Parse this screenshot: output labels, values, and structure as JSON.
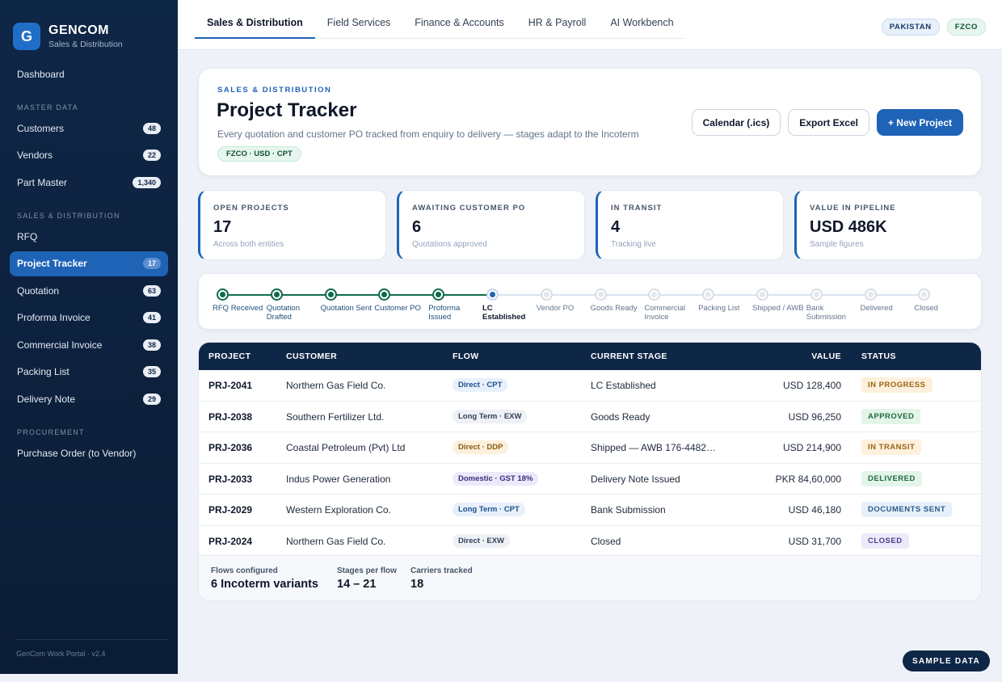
{
  "brand": {
    "logo_letter": "G",
    "title": "GENCOM",
    "subtitle": "Sales & Distribution"
  },
  "sidebar": {
    "dashboard": "Dashboard",
    "sections": [
      {
        "title": "MASTER DATA",
        "items": [
          {
            "label": "Customers",
            "count": "48"
          },
          {
            "label": "Vendors",
            "count": "22"
          },
          {
            "label": "Part Master",
            "count": "1,340"
          }
        ]
      },
      {
        "title": "SALES & DISTRIBUTION",
        "items": [
          {
            "label": "RFQ",
            "count": ""
          },
          {
            "label": "Project Tracker",
            "count": "17",
            "active": true
          },
          {
            "label": "Quotation",
            "count": "63"
          },
          {
            "label": "Proforma Invoice",
            "count": "41"
          },
          {
            "label": "Commercial Invoice",
            "count": "38"
          },
          {
            "label": "Packing List",
            "count": "35"
          },
          {
            "label": "Delivery Note",
            "count": "29"
          }
        ]
      },
      {
        "title": "PROCUREMENT",
        "items": [
          {
            "label": "Purchase Order (to Vendor)",
            "count": ""
          }
        ]
      }
    ],
    "footer": "GenCom Work Portal · v2.4"
  },
  "topnav": {
    "tabs": [
      "Sales & Distribution",
      "Field Services",
      "Finance & Accounts",
      "HR & Payroll",
      "AI Workbench"
    ],
    "region": "PAKISTAN",
    "entity": "FZCO"
  },
  "header": {
    "eyebrow": "SALES & DISTRIBUTION",
    "title": "Project Tracker",
    "description": "Every quotation and customer PO tracked from enquiry to delivery — stages adapt to the Incoterm",
    "tag": "FZCO · USD · CPT",
    "buttons": {
      "calendar": "Calendar (.ics)",
      "export": "Export Excel",
      "new": "+ New Project"
    }
  },
  "kpis": [
    {
      "label": "OPEN PROJECTS",
      "value": "17",
      "sub": "Across both entities"
    },
    {
      "label": "AWAITING CUSTOMER PO",
      "value": "6",
      "sub": "Quotations approved"
    },
    {
      "label": "IN TRANSIT",
      "value": "4",
      "sub": "Tracking live"
    },
    {
      "label": "VALUE IN PIPELINE",
      "value": "USD 486K",
      "sub": "Sample figures"
    }
  ],
  "stages": [
    {
      "label": "RFQ Received",
      "state": "done"
    },
    {
      "label": "Quotation Drafted",
      "state": "done"
    },
    {
      "label": "Quotation Sent",
      "state": "done"
    },
    {
      "label": "Customer PO",
      "state": "done"
    },
    {
      "label": "Proforma Issued",
      "state": "done"
    },
    {
      "label": "LC Established",
      "state": "current"
    },
    {
      "label": "Vendor PO",
      "state": "todo"
    },
    {
      "label": "Goods Ready",
      "state": "todo"
    },
    {
      "label": "Commercial Invoice",
      "state": "todo"
    },
    {
      "label": "Packing List",
      "state": "todo"
    },
    {
      "label": "Shipped / AWB",
      "state": "todo"
    },
    {
      "label": "Bank Submission",
      "state": "todo"
    },
    {
      "label": "Delivered",
      "state": "todo"
    },
    {
      "label": "Closed",
      "state": "todo"
    }
  ],
  "table": {
    "columns": [
      "PROJECT",
      "CUSTOMER",
      "FLOW",
      "CURRENT STAGE",
      "VALUE",
      "STATUS"
    ],
    "rows": [
      {
        "project": "PRJ-2041",
        "customer": "Northern Gas Field Co.",
        "flow": "Direct · CPT",
        "flow_style": "blue",
        "stage": "LC Established",
        "value": "USD 128,400",
        "status": "IN PROGRESS",
        "status_style": "amber"
      },
      {
        "project": "PRJ-2038",
        "customer": "Southern Fertilizer Ltd.",
        "flow": "Long Term · EXW",
        "flow_style": "gray",
        "stage": "Goods Ready",
        "value": "USD 96,250",
        "status": "APPROVED",
        "status_style": "green"
      },
      {
        "project": "PRJ-2036",
        "customer": "Coastal Petroleum (Pvt) Ltd",
        "flow": "Direct · DDP",
        "flow_style": "amber",
        "stage": "Shipped — AWB 176-4482…",
        "value": "USD 214,900",
        "status": "IN TRANSIT",
        "status_style": "amber"
      },
      {
        "project": "PRJ-2033",
        "customer": "Indus Power Generation",
        "flow": "Domestic · GST 18%",
        "flow_style": "purple",
        "stage": "Delivery Note Issued",
        "value": "PKR 84,60,000",
        "status": "DELIVERED",
        "status_style": "green"
      },
      {
        "project": "PRJ-2029",
        "customer": "Western Exploration Co.",
        "flow": "Long Term · CPT",
        "flow_style": "blue",
        "stage": "Bank Submission",
        "value": "USD 46,180",
        "status": "DOCUMENTS SENT",
        "status_style": "blue"
      },
      {
        "project": "PRJ-2024",
        "customer": "Northern Gas Field Co.",
        "flow": "Direct · EXW",
        "flow_style": "gray",
        "stage": "Closed",
        "value": "USD 31,700",
        "status": "CLOSED",
        "status_style": "purple"
      }
    ],
    "footer": [
      {
        "label": "Flows configured",
        "value": "6 Incoterm variants"
      },
      {
        "label": "Stages per flow",
        "value": "14 – 21"
      },
      {
        "label": "Carriers tracked",
        "value": "18"
      }
    ]
  },
  "sample_label": "SAMPLE DATA",
  "colors": {
    "brand": "#1e63b6",
    "navy": "#0f2747",
    "done": "#0f6b4a"
  }
}
